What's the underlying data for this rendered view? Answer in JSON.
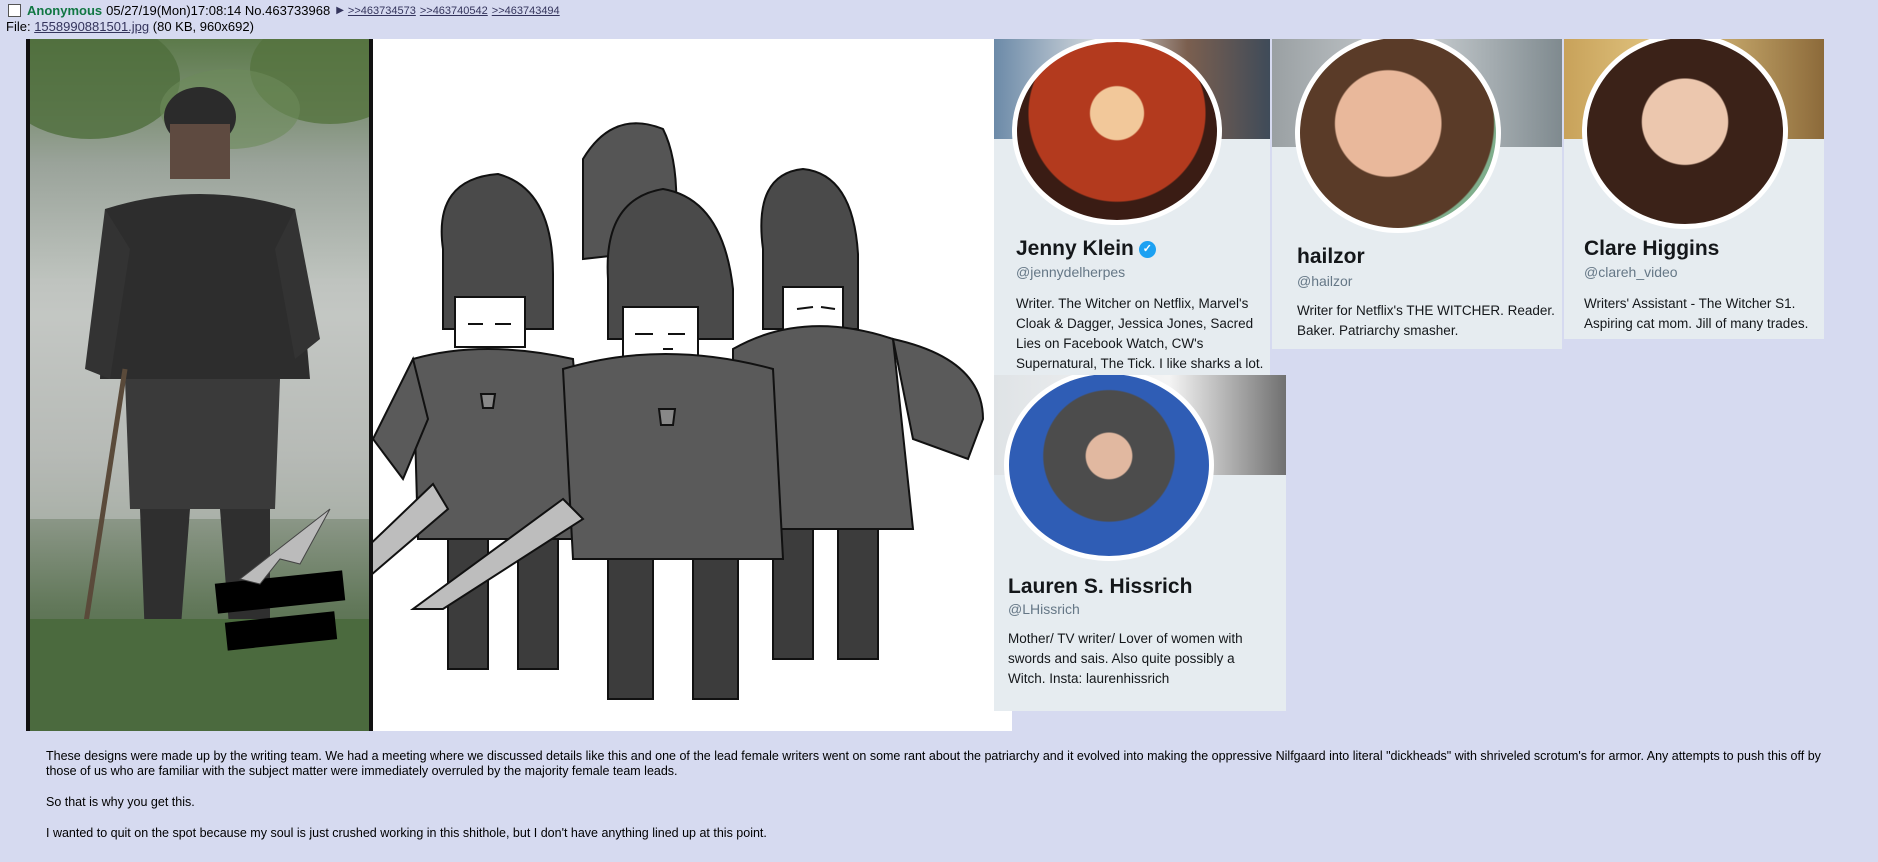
{
  "header": {
    "checkbox_state": "unchecked",
    "name": "Anonymous",
    "datetime": "05/27/19(Mon)17:08:14",
    "post_number": "No.463733968",
    "backlinks": [
      ">>463734573",
      ">>463740542",
      ">>463743494"
    ]
  },
  "file": {
    "prefix": "File:",
    "filename": "1558990881501.jpg",
    "meta": "(80 KB, 960x692)"
  },
  "profiles": [
    {
      "name": "Jenny Klein",
      "verified": true,
      "handle": "@jennydelherpes",
      "bio": "Writer. The Witcher on Netflix, Marvel's Cloak & Dagger, Jessica Jones, Sacred Lies on Facebook Watch, CW's Supernatural, The Tick. I like sharks a lot."
    },
    {
      "name": "hailzor",
      "verified": false,
      "handle": "@hailzor",
      "bio": "Writer for Netflix's THE WITCHER. Reader. Baker. Patriarchy smasher."
    },
    {
      "name": "Clare Higgins",
      "verified": false,
      "handle": "@clareh_video",
      "bio": "Writers' Assistant - The Witcher S1. Aspiring cat mom. Jill of many trades."
    },
    {
      "name": "Lauren S. Hissrich",
      "verified": false,
      "handle": "@LHissrich",
      "bio": "Mother/ TV writer/ Lover of women with swords and sais. Also quite possibly a Witch. Insta: laurenhissrich"
    }
  ],
  "post_body": [
    "These designs were made up by the writing team. We had a meeting where we discussed details like this and one of the lead female writers went on some rant about the patriarchy and it evolved into making the oppressive Nilfgaard into literal \"dickheads\" with shriveled scrotum's for armor. Any attempts to push this off by those of us who are familiar with the subject matter were immediately overruled by the majority female team leads.",
    "So that is why you get this.",
    "I wanted to quit on the spot because my soul is just crushed working in this shithole, but I don't have anything lined up at this point."
  ],
  "colors": {
    "page_bg": "#d6daf0",
    "name_green": "#117743",
    "link": "#34345c",
    "verified_blue": "#1da1f2",
    "card_bg": "#e6ecf0"
  }
}
